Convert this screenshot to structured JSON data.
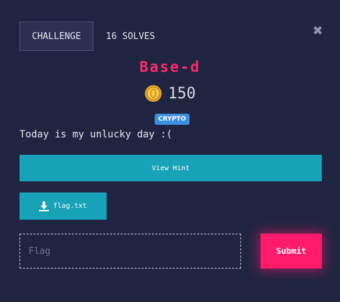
{
  "tabs": {
    "challenge_label": "CHALLENGE",
    "solves_label": "16 SOLVES"
  },
  "close_icon": "close-icon",
  "challenge": {
    "name": "Base-d",
    "value": "150",
    "category": "CRYPTO",
    "description": "Today is my unlucky day :("
  },
  "hint_button": {
    "label": "View Hint"
  },
  "file_button": {
    "label": "flag.txt",
    "icon": "download-icon"
  },
  "flag_input": {
    "placeholder": "Flag",
    "value": ""
  },
  "submit_button": {
    "label": "Submit"
  },
  "colors": {
    "background": "#1f2541",
    "title": "#ff2a6d",
    "button_teal": "#17a2b8",
    "submit_pink": "#ff1a6b",
    "tag_blue": "#3b8ee0"
  }
}
